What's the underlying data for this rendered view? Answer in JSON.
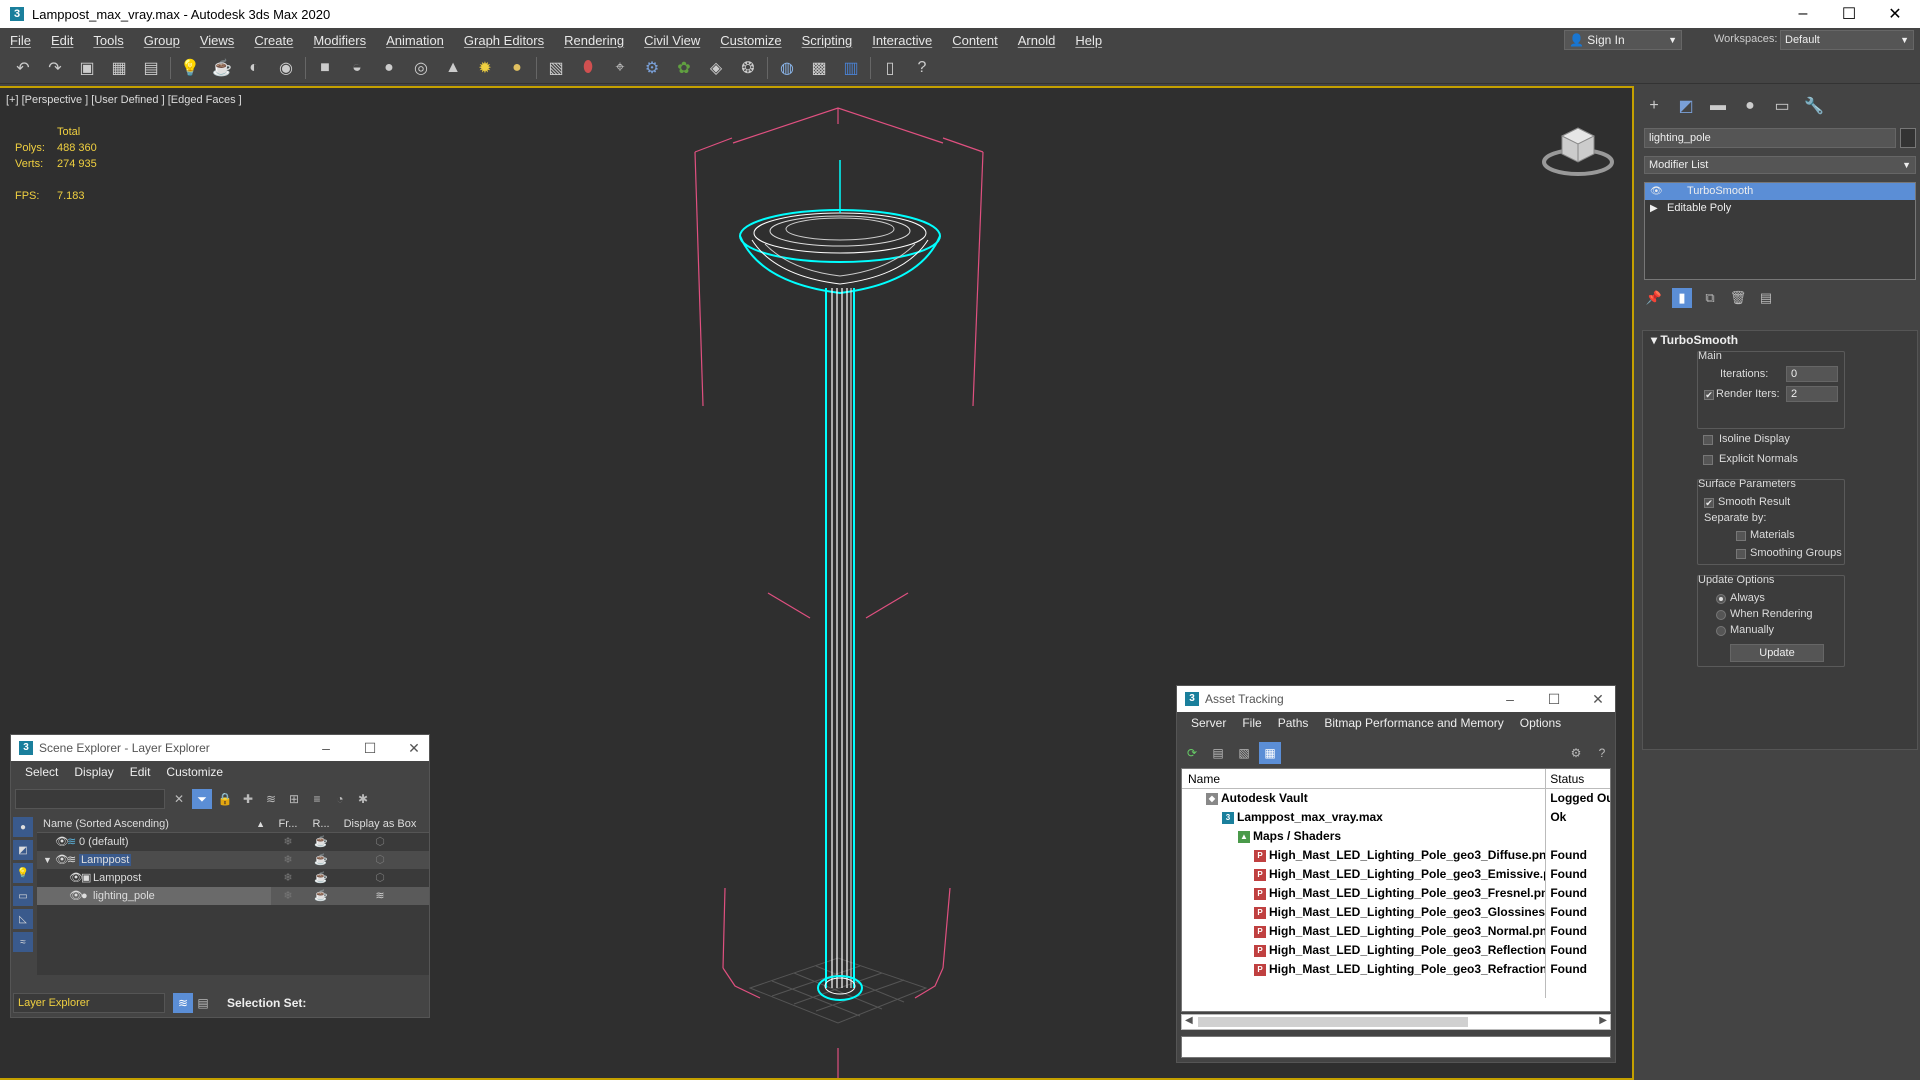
{
  "window": {
    "title": "Lamppost_max_vray.max - Autodesk 3ds Max 2020"
  },
  "menu": [
    "File",
    "Edit",
    "Tools",
    "Group",
    "Views",
    "Create",
    "Modifiers",
    "Animation",
    "Graph Editors",
    "Rendering",
    "Civil View",
    "Customize",
    "Scripting",
    "Interactive",
    "Content",
    "Arnold",
    "Help"
  ],
  "account": {
    "signin": "Sign In",
    "workspaces_label": "Workspaces:",
    "workspace": "Default"
  },
  "viewport": {
    "label": "[+] [Perspective ] [User Defined ] [Edged Faces ]",
    "stats": {
      "total_label": "Total",
      "polys_label": "Polys:",
      "polys": "488 360",
      "verts_label": "Verts:",
      "verts": "274 935",
      "fps_label": "FPS:",
      "fps": "7.183"
    }
  },
  "command_panel": {
    "object_name": "lighting_pole",
    "modifier_list": "Modifier List",
    "stack": [
      "TurboSmooth",
      "Editable Poly"
    ],
    "rollout": {
      "title": "TurboSmooth",
      "main_label": "Main",
      "iterations_label": "Iterations:",
      "iterations": "0",
      "render_iters_label": "Render Iters:",
      "render_iters": "2",
      "isoline_label": "Isoline Display",
      "explicit_normals_label": "Explicit Normals",
      "surface_params_label": "Surface Parameters",
      "smooth_result_label": "Smooth Result",
      "separate_by_label": "Separate by:",
      "materials_label": "Materials",
      "smoothing_groups_label": "Smoothing Groups",
      "update_options_label": "Update Options",
      "always_label": "Always",
      "when_rendering_label": "When Rendering",
      "manually_label": "Manually",
      "update_button": "Update"
    }
  },
  "scene_explorer": {
    "title": "Scene Explorer - Layer Explorer",
    "menu": [
      "Select",
      "Display",
      "Edit",
      "Customize"
    ],
    "columns": {
      "name": "Name (Sorted Ascending)",
      "sort": "▲",
      "frozen": "Fr...",
      "render": "R...",
      "box": "Display as Box"
    },
    "rows": [
      {
        "name": "0 (default)"
      },
      {
        "name": "Lamppost"
      },
      {
        "name": "Lamppost"
      },
      {
        "name": "lighting_pole"
      }
    ],
    "mode": "Layer Explorer",
    "selection_set_label": "Selection Set:"
  },
  "asset_tracking": {
    "title": "Asset Tracking",
    "menu": [
      "Server",
      "File",
      "Paths",
      "Bitmap Performance and Memory",
      "Options"
    ],
    "columns": {
      "name": "Name",
      "status": "Status"
    },
    "rows": [
      {
        "name": "Autodesk Vault",
        "status": "Logged Ou"
      },
      {
        "name": "Lamppost_max_vray.max",
        "status": "Ok"
      },
      {
        "name": "Maps / Shaders",
        "status": ""
      },
      {
        "name": "High_Mast_LED_Lighting_Pole_geo3_Diffuse.png",
        "status": "Found"
      },
      {
        "name": "High_Mast_LED_Lighting_Pole_geo3_Emissive.png",
        "status": "Found"
      },
      {
        "name": "High_Mast_LED_Lighting_Pole_geo3_Fresnel.png",
        "status": "Found"
      },
      {
        "name": "High_Mast_LED_Lighting_Pole_geo3_Glossiness.png",
        "status": "Found"
      },
      {
        "name": "High_Mast_LED_Lighting_Pole_geo3_Normal.png",
        "status": "Found"
      },
      {
        "name": "High_Mast_LED_Lighting_Pole_geo3_Reflection.png",
        "status": "Found"
      },
      {
        "name": "High_Mast_LED_Lighting_Pole_geo3_Refraction.png",
        "status": "Found"
      }
    ]
  },
  "colors": {
    "accent": "#5b8ed6",
    "viewport_border": "#c4a000",
    "stats_text": "#f0d040",
    "wire_select": "#00ffff",
    "bbox": "#e05080"
  }
}
